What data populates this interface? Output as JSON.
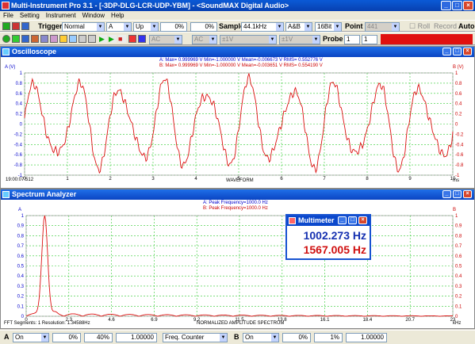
{
  "window": {
    "title": "Multi-Instrument Pro 3.1   -   [-3DP-DLG-LCR-UDP-YBM]   -   <SoundMAX Digital Audio>"
  },
  "menu": [
    "File",
    "Setting",
    "Instrument",
    "Window",
    "Help"
  ],
  "toolbar1": {
    "trigger_label": "Trigger",
    "trigger_mode": "Normal",
    "trigger_channel": "A",
    "trigger_edge": "Up",
    "level1": "0%",
    "level2": "0%",
    "sample_label": "Sample",
    "sample_rate": "44.1kHz",
    "channels": "A&B",
    "bits": "16Bit",
    "point_label": "Point",
    "points": "441",
    "roll_label": "Roll",
    "record_label": "Record",
    "auto_label": "Auto"
  },
  "toolbar2": {
    "ac1": "AC",
    "ac2": "AC",
    "v1": "±1V",
    "v2": "±1V",
    "probe_label": "Probe",
    "probe1": "1",
    "probe2": "1"
  },
  "oscilloscope": {
    "title": "Oscilloscope",
    "stats_a": "A: Max= 0.999969 V  Min=-1.000000 V  Mean=-0.006673 V  RMS= 0.552776 V",
    "stats_b": "B: Max= 0.999969 V  Min=-1.000000 V  Mean=-0.003651 V  RMS= 0.554190 V",
    "ylabel_left": "A (V)",
    "ylabel_right": "B (V)",
    "xlabel": "WAVEFORM",
    "xunit": "ms",
    "timestamp": "19:00:07.512",
    "xticks": [
      "0",
      "1",
      "2",
      "3",
      "4",
      "5",
      "6",
      "7",
      "8",
      "9",
      "10"
    ],
    "yticks": [
      "1",
      "0.8",
      "0.6",
      "0.4",
      "0.2",
      "0",
      "-0.2",
      "-0.4",
      "-0.6",
      "-0.8",
      "-1"
    ]
  },
  "spectrum": {
    "title": "Spectrum Analyzer",
    "peak_a": "A: Peak Frequency=1000.0 Hz",
    "peak_b": "B: Peak Frequency=1000.0 Hz",
    "ylabel_left": "A",
    "ylabel_right": "B",
    "xlabel": "NORMALIZED AMPLITUDE SPECTRUM",
    "xunit": "kHz",
    "footer_left": "FFT Segments: 1    Resolution: 1.34588Hz",
    "xticks": [
      "0",
      "2.3",
      "4.6",
      "6.9",
      "9.2",
      "11.5",
      "13.8",
      "16.1",
      "18.4",
      "20.7",
      "23"
    ],
    "yticks": [
      "1",
      "0.9",
      "0.8",
      "0.7",
      "0.6",
      "0.5",
      "0.4",
      "0.3",
      "0.2",
      "0.1",
      "0"
    ]
  },
  "multimeter": {
    "title": "Multimeter",
    "value_a": "1002.273 Hz",
    "value_b": "1567.005 Hz"
  },
  "bottom": {
    "a_label": "A",
    "a_state": "On",
    "a_offset": "0%",
    "a_gain": "40%",
    "a_scale": "1.00000",
    "mode": "Freq. Counter",
    "b_label": "B",
    "b_state": "On",
    "b_offset": "0%",
    "b_gain": "1%",
    "b_scale": "1.00000"
  },
  "colors": {
    "channel_a": "#0000cc",
    "channel_b": "#cc0000",
    "grid": "#33cc33"
  }
}
